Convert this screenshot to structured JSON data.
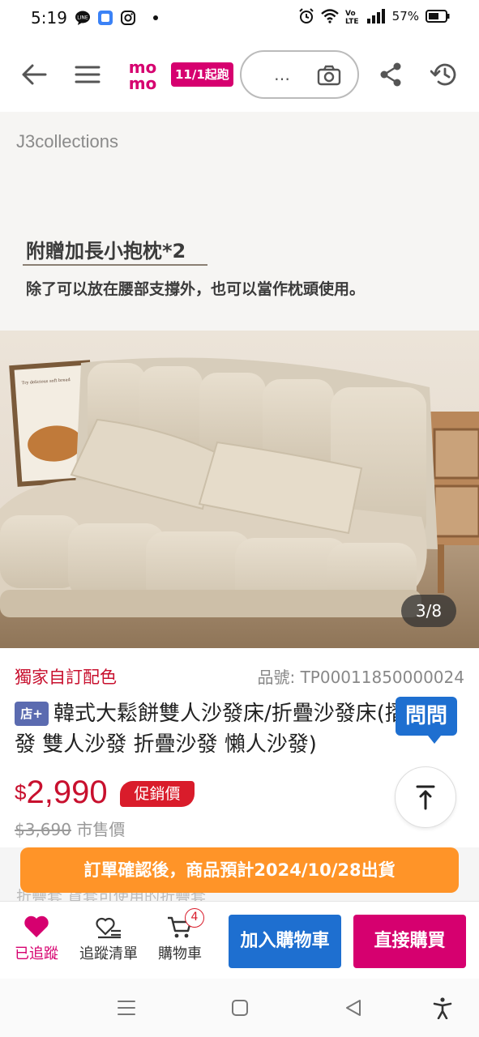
{
  "status_bar": {
    "time": "5:19",
    "battery": "57%",
    "notification_icons": [
      "line-icon",
      "chat-icon",
      "instagram-icon",
      "dot-icon"
    ],
    "system_icons": [
      "alarm-icon",
      "wifi-icon",
      "volte-icon",
      "signal-icon",
      "battery-icon"
    ]
  },
  "top_nav": {
    "logo": {
      "top": "mo",
      "bottom": "mo"
    },
    "date_badge": "11/1起跑",
    "search_placeholder": "…"
  },
  "store": {
    "name": "J3collections",
    "promo_title": "附贈加長小抱枕*2",
    "promo_sub": "除了可以放在腰部支撐外，也可以當作枕頭使用。"
  },
  "image": {
    "counter": "3/8",
    "poster_text": "Try delicious soft bread with savory butter and salty salt flavour"
  },
  "product": {
    "exclusive_tag": "獨家自訂配色",
    "sku": "品號:  TP00011850000024",
    "store_tag": "店+",
    "title": "韓式大鬆餅雙人沙發床/折疊沙發床(摺疊沙發 雙人沙發 折疊沙發 懶人沙發)",
    "qa_label": "問問",
    "price_currency": "$",
    "price": "2,990",
    "promo_badge": "促銷價",
    "original_price": "$3,690",
    "original_label": "市售價"
  },
  "shipping": {
    "banner": "訂單確認後，商品預計2024/10/28出貨",
    "peek_text": "折疊套            貨套可使用的折疊套"
  },
  "action_bar": {
    "followed": "已追蹤",
    "follow_list": "追蹤清單",
    "cart": "購物車",
    "cart_count": "4",
    "add_to_cart": "加入購物車",
    "buy_now": "直接購買"
  },
  "colors": {
    "brand_pink": "#d6006f",
    "accent_blue": "#1e6fd0",
    "price_red": "#c8102e",
    "ship_orange": "#ff9428"
  }
}
